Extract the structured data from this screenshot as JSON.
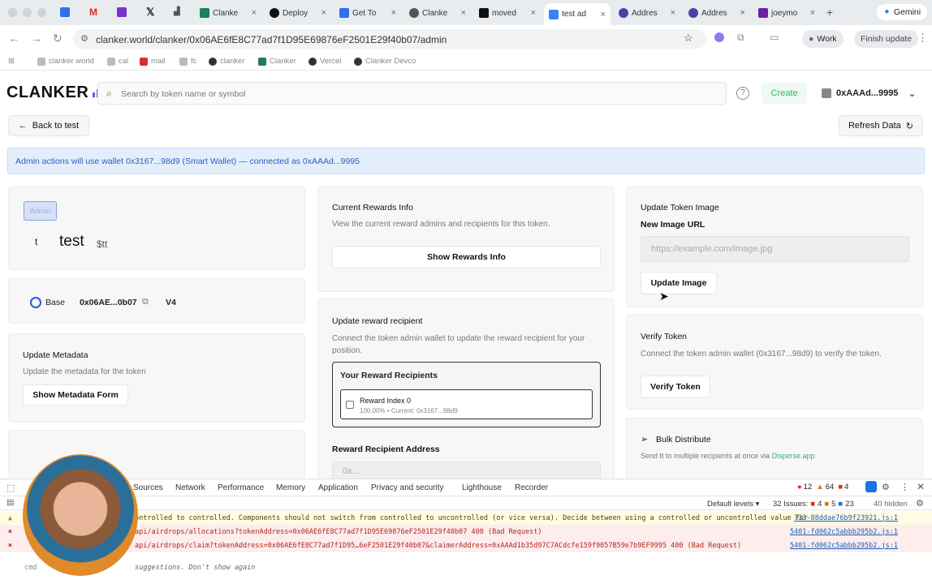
{
  "browser": {
    "tabs": [
      {
        "label": "Clanke",
        "color": "#1a7f5a"
      },
      {
        "label": "Deploy",
        "color": "#111"
      },
      {
        "label": "Get To",
        "color": "#2f6fed"
      },
      {
        "label": "Clanke",
        "color": "#555"
      },
      {
        "label": "moved",
        "color": "#111"
      },
      {
        "label": "test ad",
        "color": "#3b82f6"
      },
      {
        "label": "Addres",
        "color": "#4b3fa8"
      },
      {
        "label": "Addres",
        "color": "#4b3fa8"
      },
      {
        "label": "joeymo",
        "color": "#6b21a8"
      }
    ],
    "gemini_label": "Gemini",
    "url": "clanker.world/clanker/0x06AE6fE8C77ad7f1D95E69876eF2501E29f40b07/admin",
    "work_label": "Work",
    "finish_update_label": "Finish update",
    "bookmarks": [
      "clanker world",
      "cal",
      "mail",
      "fc",
      "clanker",
      "Clanker",
      "Vercel",
      "Clanker Devco"
    ]
  },
  "header": {
    "logo": "CLANKER",
    "search_placeholder": "Search by token name or symbol",
    "create_label": "Create",
    "account": "0xAAAd...9995"
  },
  "toolbar": {
    "back_label": "Back to test",
    "refresh_label": "Refresh Data"
  },
  "banner": "Admin actions will use wallet 0x3167...98d9 (Smart Wallet) — connected as 0xAAAd...9995",
  "token": {
    "badge": "Admin",
    "avatar_letter": "t",
    "name": "test",
    "symbol": "$tt",
    "chain": "Base",
    "address": "0x06AE...0b07",
    "version": "V4"
  },
  "metadata_card": {
    "title": "Update Metadata",
    "desc": "Update the metadata for the token",
    "button": "Show Metadata Form"
  },
  "rewards_card": {
    "title": "Current Rewards Info",
    "desc": "View the current reward admins and recipients for this token.",
    "button": "Show Rewards Info"
  },
  "recipient_card": {
    "title": "Update reward recipient",
    "desc": "Connect the token admin wallet to update the reward recipient for your position.",
    "your_recipients": "Your Reward Recipients",
    "reward_index": "Reward Index 0",
    "reward_detail": "100.00% • Current: 0x3167...98d9",
    "address_label": "Reward Recipient Address",
    "address_placeholder": "0x..."
  },
  "image_card": {
    "title": "Update Token Image",
    "label": "New Image URL",
    "placeholder": "https://example.com/image.jpg",
    "button": "Update Image"
  },
  "verify_card": {
    "title": "Verify Token",
    "desc": "Connect the token admin wallet (0x3167...98d9) to verify the token.",
    "button": "Verify Token"
  },
  "bulk_card": {
    "title": "Bulk Distribute",
    "desc": "Send tt to multiple recipients at once via",
    "link": "Disperse.app"
  },
  "devtools": {
    "tabs": [
      "Sources",
      "Network",
      "Performance",
      "Memory",
      "Application",
      "Privacy and security",
      "Lighthouse",
      "Recorder"
    ],
    "errors": "12",
    "warnings": "64",
    "info": "4",
    "default_levels": "Default levels",
    "issues_label": "32 Issues:",
    "issues_err": "4",
    "issues_warn": "5",
    "issues_info": "23",
    "hidden": "40 hidden",
    "logs": [
      {
        "text": "ontrolled to controlled. Components should not switch from controlled to uncontrolled (or vice versa). Decide between using a controlled or uncontrolled value for",
        "src": "733-88ddae76b9f23921.js:1",
        "kind": "warn"
      },
      {
        "text": "api/airdrops/allocations?tokenAddress=0x06AE6fE8C77ad7f1D95E69876eF2501E29f40b07 400 (Bad Request)",
        "src": "5401-fd062c5abbb295b2.js:1",
        "kind": "error"
      },
      {
        "text": "api/airdrops/claim?tokenAddress=0x06AE6fE8C77ad7f1D95…6eF2501E29f40b07&claimerAddress=0xAAAd1b35d97C7ACdcfe159f9057B59e7b9EF9995 400 (Bad Request)",
        "src": "5401-fd062c5abbb295b2.js:1",
        "kind": "error"
      },
      {
        "text": "suggestions.  Don't show again",
        "src": "",
        "kind": "hint"
      }
    ]
  },
  "colors": {
    "accent": "#2c5fbd",
    "create_green": "#2fb36b",
    "banner_bg": "#e4eefb"
  }
}
